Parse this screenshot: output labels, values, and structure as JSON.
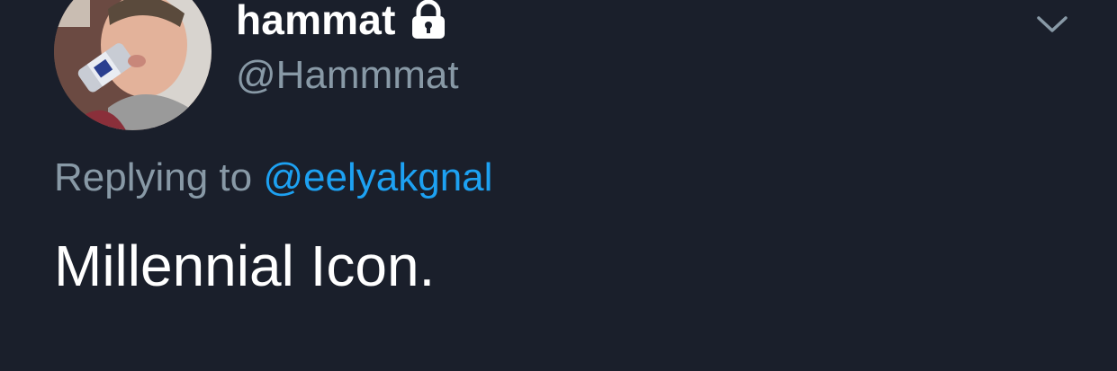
{
  "author": {
    "display_name": "hammat",
    "handle": "@Hammmat",
    "protected_icon": "lock-icon",
    "avatar_icon": "profile-photo"
  },
  "reply": {
    "prefix": "Replying to",
    "mention": "@eelyakgnal"
  },
  "tweet": {
    "text": "Millennial Icon."
  },
  "menu": {
    "icon": "chevron-down-icon"
  },
  "colors": {
    "background": "#1a1f2b",
    "primary_text": "#ffffff",
    "secondary_text": "#8899a6",
    "link": "#1da1f2"
  }
}
